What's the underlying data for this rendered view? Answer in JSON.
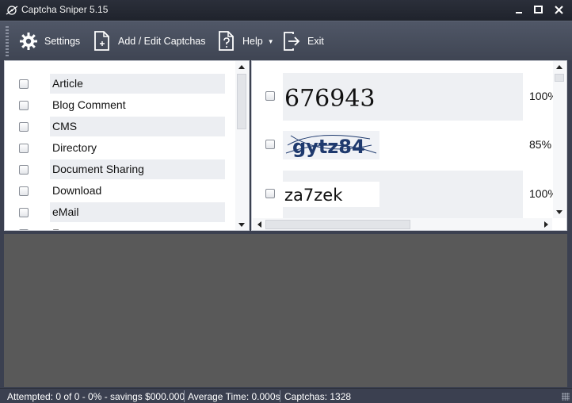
{
  "window": {
    "title": "Captcha Sniper 5.15"
  },
  "toolbar": {
    "settings_label": "Settings",
    "add_edit_label": "Add / Edit Captchas",
    "help_label": "Help",
    "exit_label": "Exit"
  },
  "categories": {
    "items": [
      {
        "label": "Article",
        "checked": false
      },
      {
        "label": "Blog Comment",
        "checked": false
      },
      {
        "label": "CMS",
        "checked": false
      },
      {
        "label": "Directory",
        "checked": false
      },
      {
        "label": "Document Sharing",
        "checked": false
      },
      {
        "label": "Download",
        "checked": false
      },
      {
        "label": "eMail",
        "checked": false
      },
      {
        "label": "F",
        "checked": false
      }
    ]
  },
  "captchas": {
    "items": [
      {
        "text": "676943",
        "confidence": "100%",
        "checked": false
      },
      {
        "text": "gytz84",
        "confidence": "85%",
        "checked": false
      },
      {
        "text": "za7zek",
        "confidence": "100%",
        "checked": false
      }
    ]
  },
  "status": {
    "attempted": "Attempted: 0 of 0 - 0% - savings $000.000",
    "average_time": "Average Time: 0.000s",
    "captchas": "Captchas: 1328"
  },
  "colors": {
    "titlebar": "#23272f",
    "toolbar": "#485060",
    "output_area": "#595959",
    "captcha_blue": "#1f3a6e"
  }
}
